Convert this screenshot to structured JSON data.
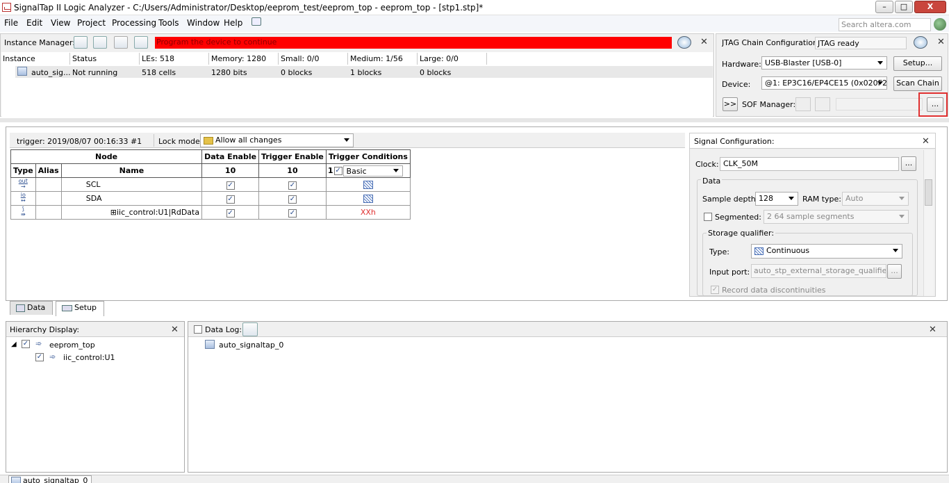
{
  "window": {
    "title": "SignalTap II Logic Analyzer - C:/Users/Administrator/Desktop/eeprom_test/eeprom_top - eeprom_top - [stp1.stp]*",
    "minimize": "–",
    "maximize": "□",
    "close": "X"
  },
  "menu": {
    "items": [
      "File",
      "Edit",
      "View",
      "Project",
      "Processing",
      "Tools",
      "Window",
      "Help"
    ]
  },
  "search": {
    "placeholder": "Search altera.com"
  },
  "instance_manager": {
    "label": "Instance Manager:",
    "status_message": "Program the device to continue",
    "columns": [
      "Instance",
      "Status",
      "LEs: 518",
      "Memory: 1280",
      "Small: 0/0",
      "Medium: 1/56",
      "Large: 0/0"
    ],
    "rows": [
      {
        "instance": "auto_sig...",
        "status": "Not running",
        "les": "518 cells",
        "memory": "1280 bits",
        "small": "0 blocks",
        "medium": "1 blocks",
        "large": "0 blocks"
      }
    ]
  },
  "jtag": {
    "label": "JTAG Chain Configuration:",
    "status": "JTAG ready",
    "hardware_label": "Hardware:",
    "hardware_value": "USB-Blaster [USB-0]",
    "setup_button": "Setup...",
    "device_label": "Device:",
    "device_value": "@1: EP3C16/EP4CE15 (0x020F2",
    "scan_chain_button": "Scan Chain",
    "expand_button": ">>",
    "sof_label": "SOF Manager:",
    "sof_browse_button": "..."
  },
  "setup": {
    "trigger_info": "trigger: 2019/08/07 00:16:33  #1",
    "lock_mode_label": "Lock mode:",
    "lock_mode_value": "Allow all changes",
    "table": {
      "header_node": "Node",
      "header_data_enable": "Data Enable",
      "header_trigger_enable": "Trigger Enable",
      "header_trigger_conditions": "Trigger Conditions",
      "sub_type": "Type",
      "sub_alias": "Alias",
      "sub_name": "Name",
      "data_enable_count": "10",
      "trigger_enable_count": "10",
      "trigger_num": "1",
      "trigger_mode": "Basic",
      "rows": [
        {
          "type": "out",
          "name": "SCL",
          "condition": ""
        },
        {
          "type": "io",
          "name": "SDA",
          "condition": ""
        },
        {
          "type": "bus",
          "expander": "⊞",
          "name": "iic_control:U1|RdData",
          "condition": "XXh"
        }
      ]
    },
    "tabs": [
      "Data",
      "Setup"
    ]
  },
  "signal_config": {
    "label": "Signal Configuration:",
    "clock_label": "Clock:",
    "clock_value": "CLK_50M",
    "clock_browse": "...",
    "data_group": "Data",
    "sample_depth_label": "Sample depth:",
    "sample_depth_value": "128",
    "ram_type_label": "RAM type:",
    "ram_type_value": "Auto",
    "segmented_label": "Segmented:",
    "segmented_value": "2  64 sample segments",
    "storage_qualifier_label": "Storage qualifier:",
    "type_label": "Type:",
    "type_value": "Continuous",
    "input_port_label": "Input port:",
    "input_port_value": "auto_stp_external_storage_qualifier",
    "input_port_browse": "...",
    "record_label": "Record data discontinuities"
  },
  "hierarchy": {
    "label": "Hierarchy Display:",
    "items": [
      {
        "name": "eeprom_top"
      },
      {
        "name": "iic_control:U1"
      }
    ]
  },
  "data_log": {
    "label": "Data Log:",
    "items": [
      "auto_signaltap_0"
    ]
  },
  "bottom_tab": {
    "label": "auto_signaltap_0"
  },
  "colors": {
    "status_red": "#ff0000",
    "highlight_box": "#e03030",
    "accent_blue": "#2a4d8f"
  }
}
